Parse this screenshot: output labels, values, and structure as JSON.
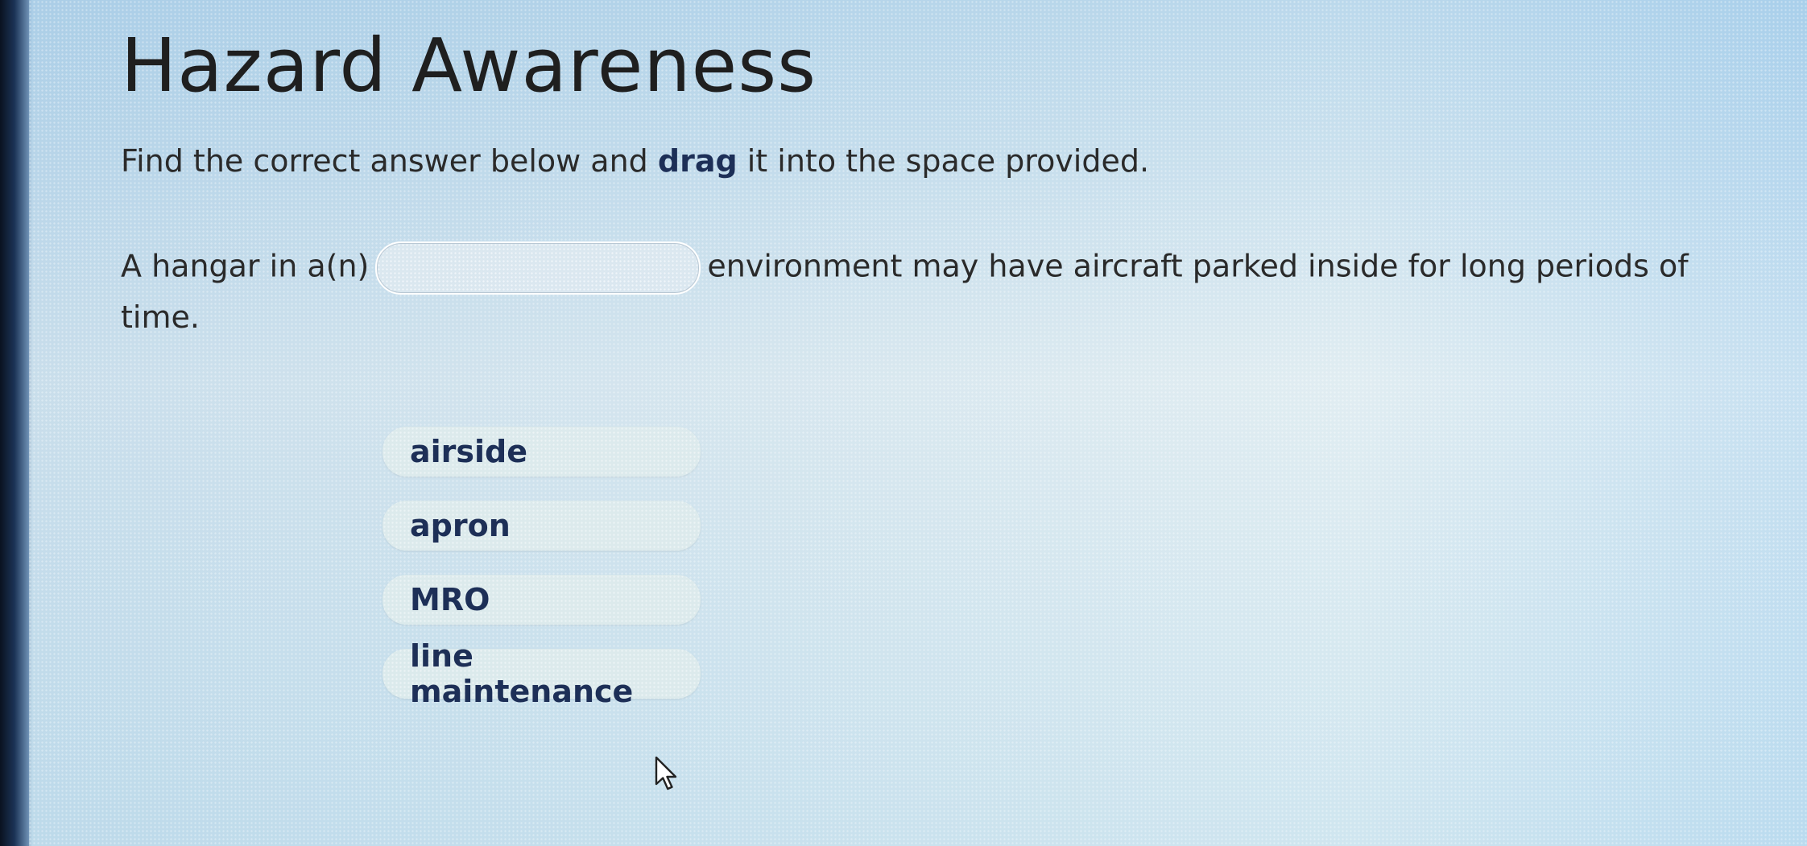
{
  "page": {
    "title": "Hazard Awareness"
  },
  "instruction": {
    "before": "Find the correct answer below and ",
    "emphasis": "drag",
    "after": " it into the space provided."
  },
  "question": {
    "before_blank": "A hangar in a(n)",
    "after_blank": "environment may have aircraft parked inside for long periods of time."
  },
  "answers": [
    {
      "label": "airside"
    },
    {
      "label": "apron"
    },
    {
      "label": "MRO"
    },
    {
      "label": "line maintenance"
    }
  ],
  "colors": {
    "accent_text": "#1d2f57",
    "body_text": "#2a2a2a"
  },
  "icons": {
    "cursor": "mouse-pointer-icon"
  }
}
